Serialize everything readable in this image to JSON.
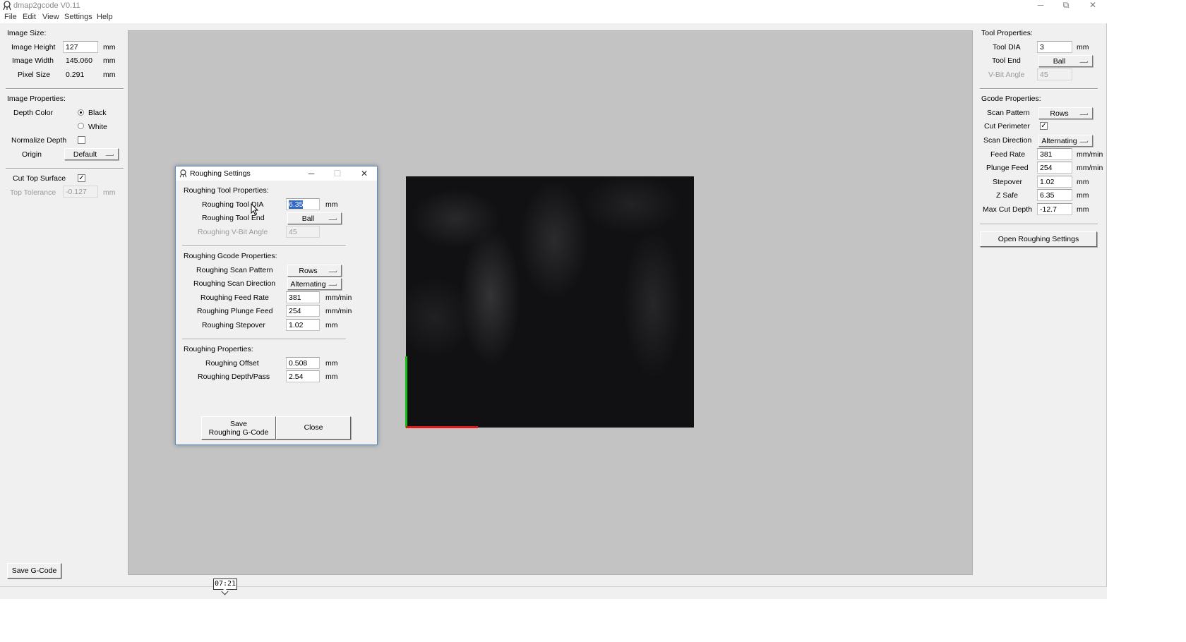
{
  "window": {
    "title": "dmap2gcode V0.11",
    "minimize": "─",
    "restore": "⧉",
    "close": "✕"
  },
  "menu": [
    "File",
    "Edit",
    "View",
    "Settings",
    "Help"
  ],
  "left": {
    "image_size_header": "Image Size:",
    "image_height_label": "Image Height",
    "image_height_value": "127",
    "image_width_label": "Image Width",
    "image_width_value": "145.060",
    "pixel_size_label": "Pixel Size",
    "pixel_size_value": "0.291",
    "unit_mm": "mm",
    "image_props_header": "Image Properties:",
    "depth_color_label": "Depth Color",
    "black_label": "Black",
    "white_label": "White",
    "depth_color_selected": "Black",
    "normalize_label": "Normalize Depth",
    "normalize_checked": false,
    "origin_label": "Origin",
    "origin_value": "Default",
    "cut_top_label": "Cut Top Surface",
    "cut_top_checked": true,
    "top_tol_label": "Top Tolerance",
    "top_tol_value": "-0.127",
    "save_gcode": "Save G-Code"
  },
  "right": {
    "tool_props_header": "Tool Properties:",
    "tool_dia_label": "Tool DIA",
    "tool_dia_value": "3",
    "tool_end_label": "Tool End",
    "tool_end_value": "Ball",
    "vbit_label": "V-Bit Angle",
    "vbit_value": "45",
    "gcode_props_header": "Gcode Properties:",
    "scan_pattern_label": "Scan Pattern",
    "scan_pattern_value": "Rows",
    "cut_perimeter_label": "Cut Perimeter",
    "cut_perimeter_checked": true,
    "scan_direction_label": "Scan Direction",
    "scan_direction_value": "Alternating",
    "feed_rate_label": "Feed Rate",
    "feed_rate_value": "381",
    "plunge_feed_label": "Plunge Feed",
    "plunge_feed_value": "254",
    "stepover_label": "Stepover",
    "stepover_value": "1.02",
    "zsafe_label": "Z Safe",
    "zsafe_value": "6.35",
    "max_cut_label": "Max Cut Depth",
    "max_cut_value": "-12.7",
    "unit_mm": "mm",
    "unit_mmmin": "mm/min",
    "open_roughing": "Open Roughing Settings"
  },
  "dialog": {
    "title": "Roughing Settings",
    "tool_header": "Roughing Tool Properties:",
    "tool_dia_label": "Roughing Tool DIA",
    "tool_dia_value": "6.35",
    "tool_end_label": "Roughing Tool End",
    "tool_end_value": "Ball",
    "vbit_label": "Roughing V-Bit Angle",
    "vbit_value": "45",
    "gcode_header": "Roughing Gcode Properties:",
    "scan_pattern_label": "Roughing Scan Pattern",
    "scan_pattern_value": "Rows",
    "scan_direction_label": "Roughing Scan Direction",
    "scan_direction_value": "Alternating",
    "feed_rate_label": "Roughing Feed Rate",
    "feed_rate_value": "381",
    "plunge_feed_label": "Roughing Plunge Feed",
    "plunge_feed_value": "254",
    "stepover_label": "Roughing Stepover",
    "stepover_value": "1.02",
    "props_header": "Roughing Properties:",
    "offset_label": "Roughing Offset",
    "offset_value": "0.508",
    "depth_pass_label": "Roughing Depth/Pass",
    "depth_pass_value": "2.54",
    "unit_mm": "mm",
    "unit_mmmin": "mm/min",
    "save_line1": "Save",
    "save_line2": "Roughing G-Code",
    "close_label": "Close"
  },
  "timestamp": "07:21",
  "colors": {
    "canvas_bg": "#c3c3c4",
    "image_bg": "#111113",
    "x_axis": "#dd1a1a",
    "y_axis": "#15c015",
    "selection": "#3168c4"
  },
  "icons": {
    "app": "feather-icon",
    "dropdown": "option-menu-indicator-icon",
    "cursor": "arrow-cursor-icon"
  }
}
